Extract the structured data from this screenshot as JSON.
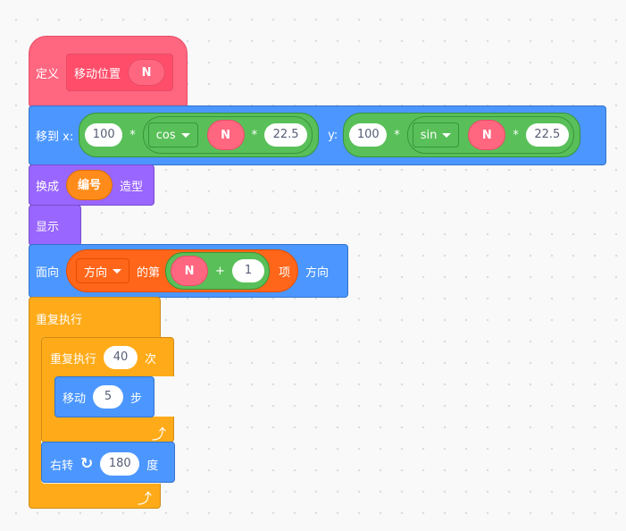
{
  "define": {
    "label": "定义",
    "name": "移动位置",
    "param": "N"
  },
  "goto": {
    "label": "移到 x:",
    "x": {
      "mult": "100",
      "func": "cos",
      "param": "N",
      "value": "22.5"
    },
    "y_label": "y:",
    "y": {
      "mult": "100",
      "func": "sin",
      "param": "N",
      "value": "22.5"
    },
    "times": "*"
  },
  "costume": {
    "label": "换成",
    "value": "编号",
    "suffix": "造型"
  },
  "show": {
    "label": "显示"
  },
  "point": {
    "label": "面向",
    "list": "方向",
    "of": "的第",
    "param": "N",
    "plus": "+",
    "add": "1",
    "item": "项",
    "suffix": "方向"
  },
  "forever": {
    "label": "重复执行"
  },
  "repeat": {
    "label": "重复执行",
    "count": "40",
    "suffix": "次"
  },
  "move": {
    "label": "移动",
    "steps": "5",
    "suffix": "步"
  },
  "turn": {
    "label": "右转",
    "degrees": "180",
    "suffix": "度"
  },
  "colors": {
    "custom": "#ff6680",
    "motion": "#4c97ff",
    "operators": "#59c059",
    "looks": "#9966ff",
    "variables": "#ff661a",
    "control": "#ffab19"
  }
}
